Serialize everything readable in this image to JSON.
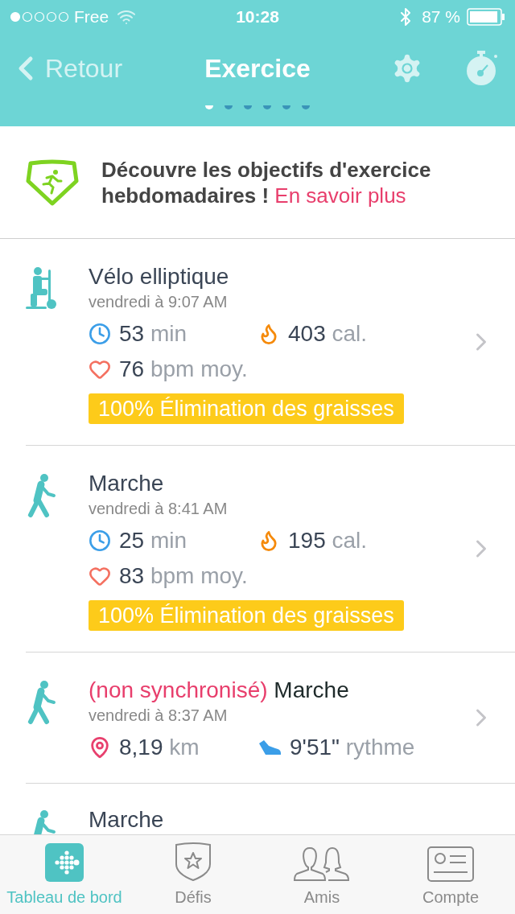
{
  "status_bar": {
    "carrier": "Free",
    "time": "10:28",
    "battery": "87 %"
  },
  "nav": {
    "back": "Retour",
    "title": "Exercice",
    "pages": [
      {
        "selected": true
      },
      {
        "selected": false
      },
      {
        "selected": false
      },
      {
        "selected": false
      },
      {
        "selected": false
      },
      {
        "selected": false
      }
    ]
  },
  "banner": {
    "text": "Découvre les objectifs d'exercice hebdomadaires !",
    "link": "En savoir plus"
  },
  "activities": [
    {
      "kind": "elliptical",
      "name": "Vélo elliptique",
      "time": "vendredi à 9:07 AM",
      "stats": [
        {
          "kind": "duration",
          "value": "53",
          "unit": "min"
        },
        {
          "kind": "calories",
          "value": "403",
          "unit": "cal."
        },
        {
          "kind": "heart",
          "value": "76",
          "unit": "bpm moy."
        }
      ],
      "badge": "100% Élimination des graisses"
    },
    {
      "kind": "walk",
      "name": "Marche",
      "time": "vendredi à 8:41 AM",
      "stats": [
        {
          "kind": "duration",
          "value": "25",
          "unit": "min"
        },
        {
          "kind": "calories",
          "value": "195",
          "unit": "cal."
        },
        {
          "kind": "heart",
          "value": "83",
          "unit": "bpm moy."
        }
      ],
      "badge": "100% Élimination des graisses"
    },
    {
      "kind": "walk",
      "status": "(non synchronisé)",
      "name": "Marche",
      "time": "vendredi à 8:37 AM",
      "stats": [
        {
          "kind": "distance",
          "value": "8,19",
          "unit": "km"
        },
        {
          "kind": "pace",
          "value": "9'51\"",
          "unit": "rythme"
        }
      ]
    },
    {
      "kind": "walk",
      "name": "Marche"
    }
  ],
  "tab_bar": [
    {
      "kind": "dashboard",
      "label": "Tableau de bord",
      "selected": true
    },
    {
      "kind": "challenges",
      "label": "Défis",
      "selected": false
    },
    {
      "kind": "friends",
      "label": "Amis",
      "selected": false
    },
    {
      "kind": "account",
      "label": "Compte",
      "selected": false
    }
  ]
}
